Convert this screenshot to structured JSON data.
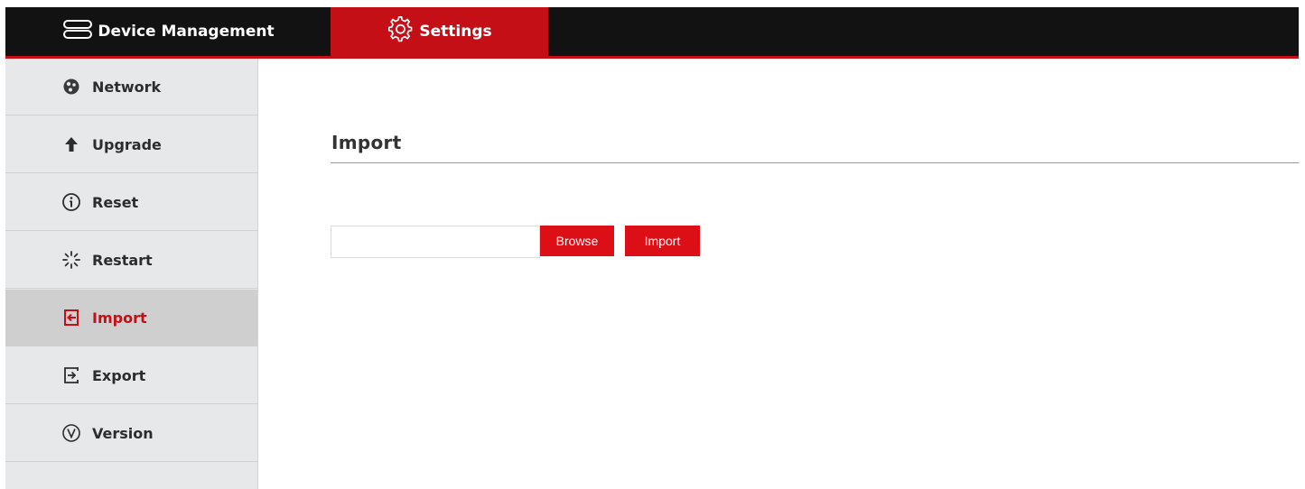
{
  "header": {
    "tabs": [
      {
        "label": "Device Management",
        "icon": "device-stack-icon",
        "active": false
      },
      {
        "label": "Settings",
        "icon": "gear-icon",
        "active": true
      }
    ]
  },
  "sidebar": {
    "items": [
      {
        "label": "Network",
        "icon": "network-icon",
        "active": false
      },
      {
        "label": "Upgrade",
        "icon": "arrow-up-icon",
        "active": false
      },
      {
        "label": "Reset",
        "icon": "info-circle-icon",
        "active": false
      },
      {
        "label": "Restart",
        "icon": "spinner-icon",
        "active": false
      },
      {
        "label": "Import",
        "icon": "import-icon",
        "active": true
      },
      {
        "label": "Export",
        "icon": "export-icon",
        "active": false
      },
      {
        "label": "Version",
        "icon": "version-icon",
        "active": false
      }
    ]
  },
  "main": {
    "title": "Import",
    "file_field": {
      "value": "",
      "placeholder": ""
    },
    "browse_label": "Browse",
    "import_label": "Import"
  },
  "colors": {
    "accent": "#c40f17",
    "topbar": "#121212",
    "sidebar_bg": "#e7e8ea",
    "sidebar_active_bg": "#cfcfcf"
  }
}
